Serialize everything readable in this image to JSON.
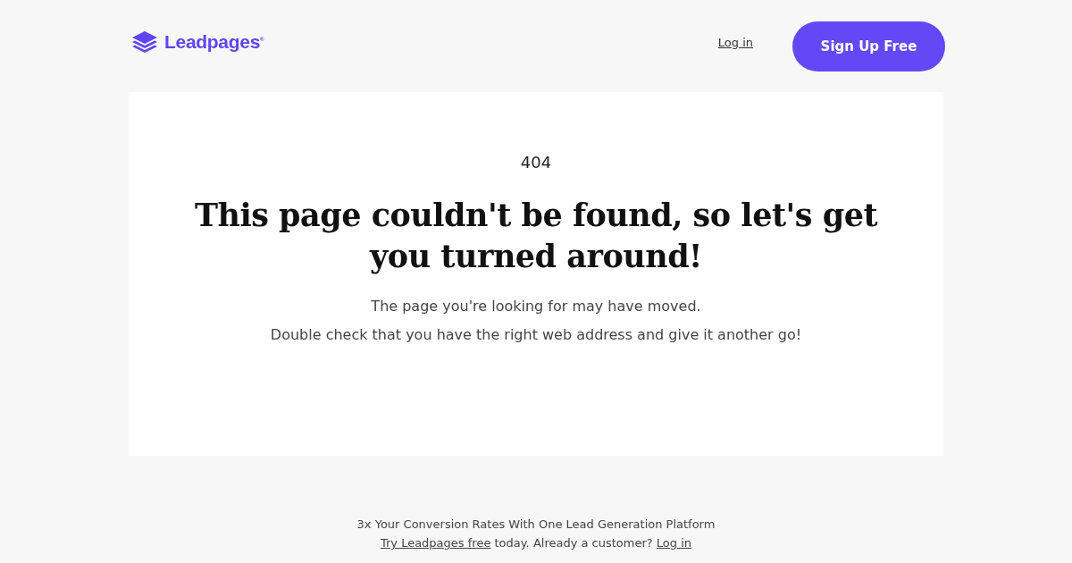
{
  "header": {
    "logo": "Leadpages$^{®}$",
    "login": "Log in",
    "signup": "Sign Up Free"
  },
  "error": {
    "code": "404",
    "title": "This page couldn't be found, so let's get you turned around!",
    "lines": [
      "The page you're looking for may have moved.",
      "Double check that you have the right web address and give it another go!"
    ]
  },
  "footer": {
    "tagline": "3x Your Conversion Rates With One Lead Generation Platform",
    "line": [
      {
        "kind": "link",
        "text": "Try Leadpages free"
      },
      {
        "kind": "text",
        "text": " today. Already a customer? "
      },
      {
        "kind": "link",
        "text": "Log in"
      }
    ]
  }
}
